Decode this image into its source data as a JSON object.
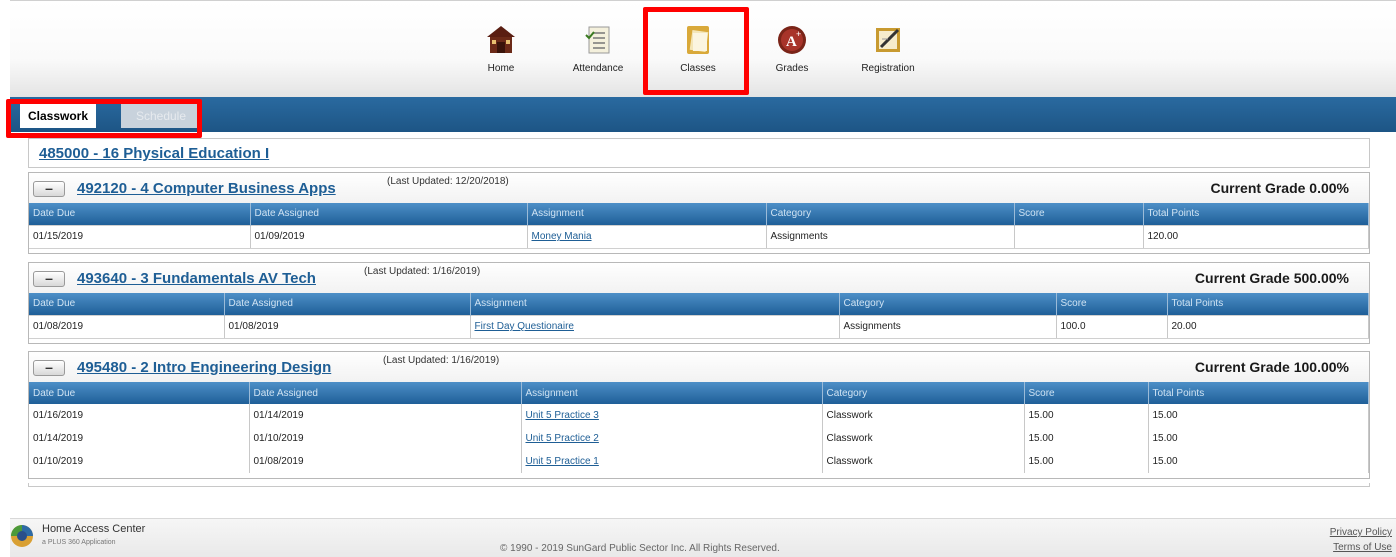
{
  "nav": {
    "items": [
      {
        "label": "Home"
      },
      {
        "label": "Attendance"
      },
      {
        "label": "Classes"
      },
      {
        "label": "Grades"
      },
      {
        "label": "Registration"
      }
    ]
  },
  "tabs": {
    "classwork": "Classwork",
    "schedule": "Schedule"
  },
  "top_course": "485000 - 16 Physical Education I",
  "columns": [
    "Date Due",
    "Date Assigned",
    "Assignment",
    "Category",
    "Score",
    "Total Points"
  ],
  "courses": [
    {
      "title": "492120 - 4 Computer Business Apps",
      "last_updated": "(Last Updated: 12/20/2018)",
      "current_grade": "Current Grade 0.00%",
      "rows": [
        [
          "01/15/2019",
          "01/09/2019",
          "Money Mania",
          "Assignments",
          "",
          "120.00"
        ]
      ]
    },
    {
      "title": "493640 - 3 Fundamentals AV Tech",
      "last_updated": "(Last Updated: 1/16/2019)",
      "current_grade": "Current Grade 500.00%",
      "rows": [
        [
          "01/08/2019",
          "01/08/2019",
          "First Day Questionaire",
          "Assignments",
          "100.0",
          "20.00"
        ]
      ]
    },
    {
      "title": "495480 - 2 Intro Engineering Design",
      "last_updated": "(Last Updated: 1/16/2019)",
      "current_grade": "Current Grade 100.00%",
      "rows": [
        [
          "01/16/2019",
          "01/14/2019",
          "Unit 5 Practice 3",
          "Classwork",
          "15.00",
          "15.00"
        ],
        [
          "01/14/2019",
          "01/10/2019",
          "Unit 5 Practice 2",
          "Classwork",
          "15.00",
          "15.00"
        ],
        [
          "01/10/2019",
          "01/08/2019",
          "Unit 5 Practice 1",
          "Classwork",
          "15.00",
          "15.00"
        ]
      ]
    }
  ],
  "footer": {
    "app_name": "Home Access Center",
    "app_sub": "a PLUS 360 Application",
    "copyright": "© 1990 - 2019 SunGard Public Sector Inc. All Rights Reserved.",
    "privacy": "Privacy Policy",
    "terms": "Terms of Use"
  }
}
